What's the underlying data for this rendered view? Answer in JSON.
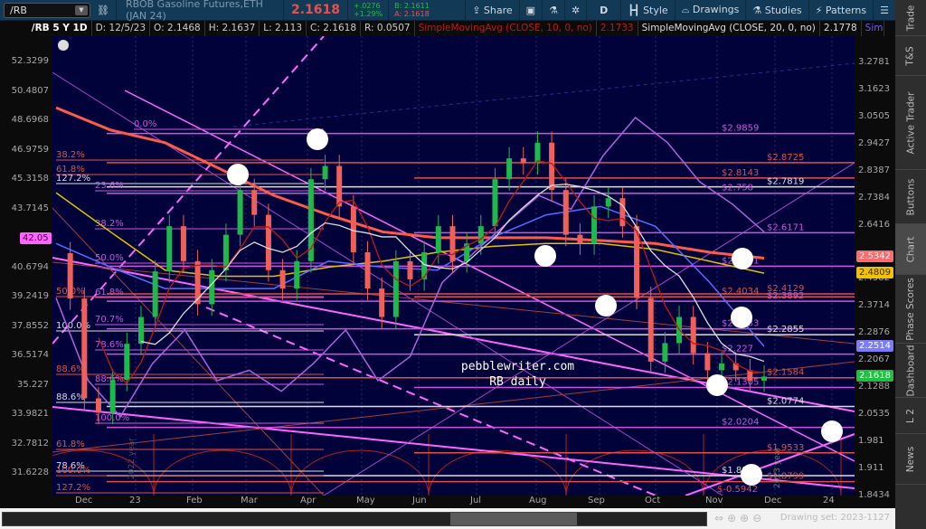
{
  "toolbar": {
    "symbol": "/RB",
    "description": "RBOB Gasoline Futures,ETH (JAN 24)",
    "last": "2.1618",
    "change": "+.0276",
    "change_pct": "+1.29%",
    "bid": "B: 2.1611",
    "ask": "A: 2.1618",
    "share": "Share",
    "period": "D",
    "style": "Style",
    "drawings": "Drawings",
    "studies": "Studies",
    "patterns": "Patterns"
  },
  "infobar": {
    "chart_id": "/RB 5 Y 1D",
    "date": "D: 12/5/23",
    "open": "O: 2.1468",
    "high": "H: 2.1637",
    "low": "L: 2.113",
    "close": "C: 2.1618",
    "range": "R: 0.0507",
    "sma10": "SimpleMovingAvg (CLOSE, 10, 0, no)",
    "sma10_val": "2.1733",
    "sma20": "SimpleMovingAvg (CLOSE, 20, 0, no)",
    "sma20_val": "2.1778",
    "more": "Simple..."
  },
  "left_axis": {
    "ticks": [
      "52.3299",
      "50.4807",
      "48.6968",
      "46.9759",
      "45.3158",
      "43.7145",
      "42.05",
      "40.6794",
      "39.2419",
      "37.8552",
      "36.5174",
      "35.227",
      "33.9821",
      "32.7812",
      "31.6228"
    ],
    "marker": "42.05",
    "marker_color": "#ff66ff"
  },
  "right_axis": {
    "ticks": [
      "3.2781",
      "3.1623",
      "3.0505",
      "2.9427",
      "2.8387",
      "2.7384",
      "2.6416",
      "2.4582",
      "2.3714",
      "2.2876",
      "2.2067",
      "2.1288",
      "2.0535",
      "1.981",
      "1.911",
      "1.8434"
    ],
    "badges": [
      {
        "label": "2.5342",
        "color": "#ff6b6b"
      },
      {
        "label": "2.4809",
        "color": "#f2c200"
      },
      {
        "label": "2.2514",
        "color": "#7b7bff"
      },
      {
        "label": "2.1618",
        "color": "#1ec040"
      }
    ]
  },
  "x_axis": [
    "Dec",
    "23",
    "Feb",
    "Mar",
    "Apr",
    "May",
    "Jun",
    "Jul",
    "Aug",
    "Sep",
    "Oct",
    "Nov",
    "Dec",
    "24"
  ],
  "side_tabs": [
    "Trade",
    "T&S",
    "Active Trader",
    "Buttons",
    "Chart",
    "Phase Scores",
    "Dashboard",
    "L 2",
    "News"
  ],
  "fib_labels": [
    "0.0%",
    "38.2%",
    "61.8%",
    "127.2%",
    "23.6%",
    "38.2%",
    "50.0%",
    "50.0%",
    "61.8%",
    "70.7%",
    "100.0%",
    "78.6%",
    "88.6%",
    "88.6%",
    "88.6%",
    "100.0%",
    "61.8%",
    "78.6%",
    "100.0%",
    "127.2%"
  ],
  "levels": [
    {
      "price": 2.9859,
      "label": "$2.9859",
      "color": "#cc55dd"
    },
    {
      "price": 2.8725,
      "label": "$2.8725",
      "color": "#e0504a"
    },
    {
      "price": 2.8143,
      "label": "$2.8143",
      "color": "#e0504a"
    },
    {
      "price": 2.7819,
      "label": "$2.7819",
      "color": "#dddddd"
    },
    {
      "price": 2.758,
      "label": "$2.758",
      "color": "#cc55dd"
    },
    {
      "price": 2.6171,
      "label": "$2.6171",
      "color": "#cc55dd"
    },
    {
      "price": 2.5031,
      "label": "$2.5031",
      "color": "#cc55dd"
    },
    {
      "price": 2.4129,
      "label": "$2.4129",
      "color": "#e0504a"
    },
    {
      "price": 2.4034,
      "label": "$2.4034",
      "color": "#e0504a"
    },
    {
      "price": 2.3892,
      "label": "$2.3892",
      "color": "#cc55dd"
    },
    {
      "price": 2.3033,
      "label": "$2.3033",
      "color": "#cc55dd"
    },
    {
      "price": 2.2855,
      "label": "$2.2855",
      "color": "#dddddd"
    },
    {
      "price": 2.227,
      "label": "$2.227",
      "color": "#cc55dd"
    },
    {
      "price": 2.1584,
      "label": "$2.1584",
      "color": "#e0504a"
    },
    {
      "price": 2.1305,
      "label": "$2.1305",
      "color": "#cc55dd"
    },
    {
      "price": 2.0774,
      "label": "$2.0774",
      "color": "#dddddd"
    },
    {
      "price": 2.0204,
      "label": "$2.0204",
      "color": "#cc55dd"
    },
    {
      "price": 1.9533,
      "label": "$1.9533",
      "color": "#e0504a"
    },
    {
      "price": 1.8949,
      "label": "$1.8949",
      "color": "#dddddd"
    },
    {
      "price": 1.8799,
      "label": "$1.8799",
      "color": "#e0504a"
    }
  ],
  "neg_label": "$-0.5942",
  "watermark": {
    "line1": "pebblewriter.com",
    "line2": "RB daily"
  },
  "cycle_labels": [
    "2022 year",
    "2023 year"
  ],
  "drawing_set": "Drawing set: 2023-1127",
  "chart_data": {
    "type": "candlestick",
    "symbol": "/RB",
    "scale": "log",
    "ylim": [
      1.8434,
      3.35
    ],
    "closes": [
      2.547,
      2.398,
      2.1,
      2.06,
      2.152,
      2.258,
      2.34,
      2.486,
      2.64,
      2.52,
      2.38,
      2.49,
      2.61,
      2.77,
      2.68,
      2.49,
      2.43,
      2.52,
      2.81,
      2.86,
      2.71,
      2.55,
      2.43,
      2.34,
      2.52,
      2.46,
      2.55,
      2.64,
      2.52,
      2.58,
      2.64,
      2.81,
      2.889,
      2.87,
      2.95,
      2.77,
      2.61,
      2.58,
      2.71,
      2.74,
      2.64,
      2.4,
      2.205,
      2.26,
      2.34,
      2.23,
      2.18,
      2.2,
      2.18,
      2.15,
      2.1618
    ],
    "series": [
      {
        "name": "SMA long (red)",
        "color": "#ff5a4a",
        "values": [
          3.09,
          3.0,
          2.95,
          2.85,
          2.75,
          2.68,
          2.62,
          2.6,
          2.6,
          2.6,
          2.59,
          2.58,
          2.55,
          2.53
        ]
      },
      {
        "name": "SMA (yellow)",
        "color": "#e0c000",
        "values": [
          2.76,
          2.62,
          2.49,
          2.47,
          2.47,
          2.5,
          2.52,
          2.55,
          2.57,
          2.58,
          2.58,
          2.56,
          2.52,
          2.48
        ]
      },
      {
        "name": "SMA (blue)",
        "color": "#5a6cff",
        "values": [
          2.58,
          2.5,
          2.43,
          2.43,
          2.43,
          2.52,
          2.5,
          2.49,
          2.6,
          2.68,
          2.71,
          2.64,
          2.45,
          2.25
        ]
      },
      {
        "name": "Ratio (purple)",
        "color": "#b060e0",
        "values": [
          2.4,
          2.15,
          2.05,
          2.2,
          2.3,
          2.15,
          2.18,
          2.12,
          2.2,
          2.3,
          2.15,
          2.22,
          2.45,
          2.55,
          2.65,
          2.75,
          2.7,
          2.9,
          3.05,
          2.95,
          2.8,
          2.72,
          2.62
        ]
      }
    ]
  }
}
